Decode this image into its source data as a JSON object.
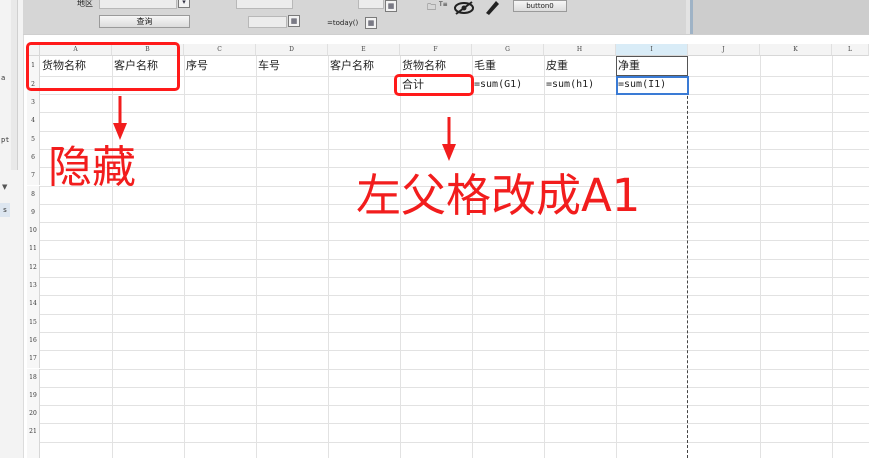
{
  "toolbar": {
    "region_label": "地区",
    "query_label": "查询",
    "today_formula": "=today()",
    "text_icon_label": "T≡",
    "button0_label": "button0"
  },
  "left_rail": {
    "mark_a": "a",
    "mark_pt": "pt",
    "arrow": "▼",
    "selected": "s"
  },
  "columns": [
    "A",
    "B",
    "C",
    "D",
    "E",
    "F",
    "G",
    "H",
    "I",
    "J",
    "K",
    "L"
  ],
  "rows": [
    "1",
    "2",
    "3",
    "4",
    "5",
    "6",
    "7",
    "8",
    "9",
    "10",
    "11",
    "12",
    "13",
    "14",
    "15",
    "16",
    "17",
    "18",
    "19",
    "20",
    "21"
  ],
  "cells": {
    "A1": "货物名称",
    "B1": "客户名称",
    "C1": "序号",
    "D1": "车号",
    "E1": "客户名称",
    "F1": "货物名称",
    "G1": "毛重",
    "H1": "皮重",
    "I1": "净重",
    "F2": "合计",
    "G2": "=sum(G1)",
    "H2": "=sum(h1)",
    "I2": "=sum(I1)"
  },
  "annotations": {
    "hide": "隐藏",
    "parent_cell": "左父格改成A1"
  },
  "colors": {
    "annotation_red": "#f21d1d",
    "selection_blue": "#3a7bd5"
  }
}
